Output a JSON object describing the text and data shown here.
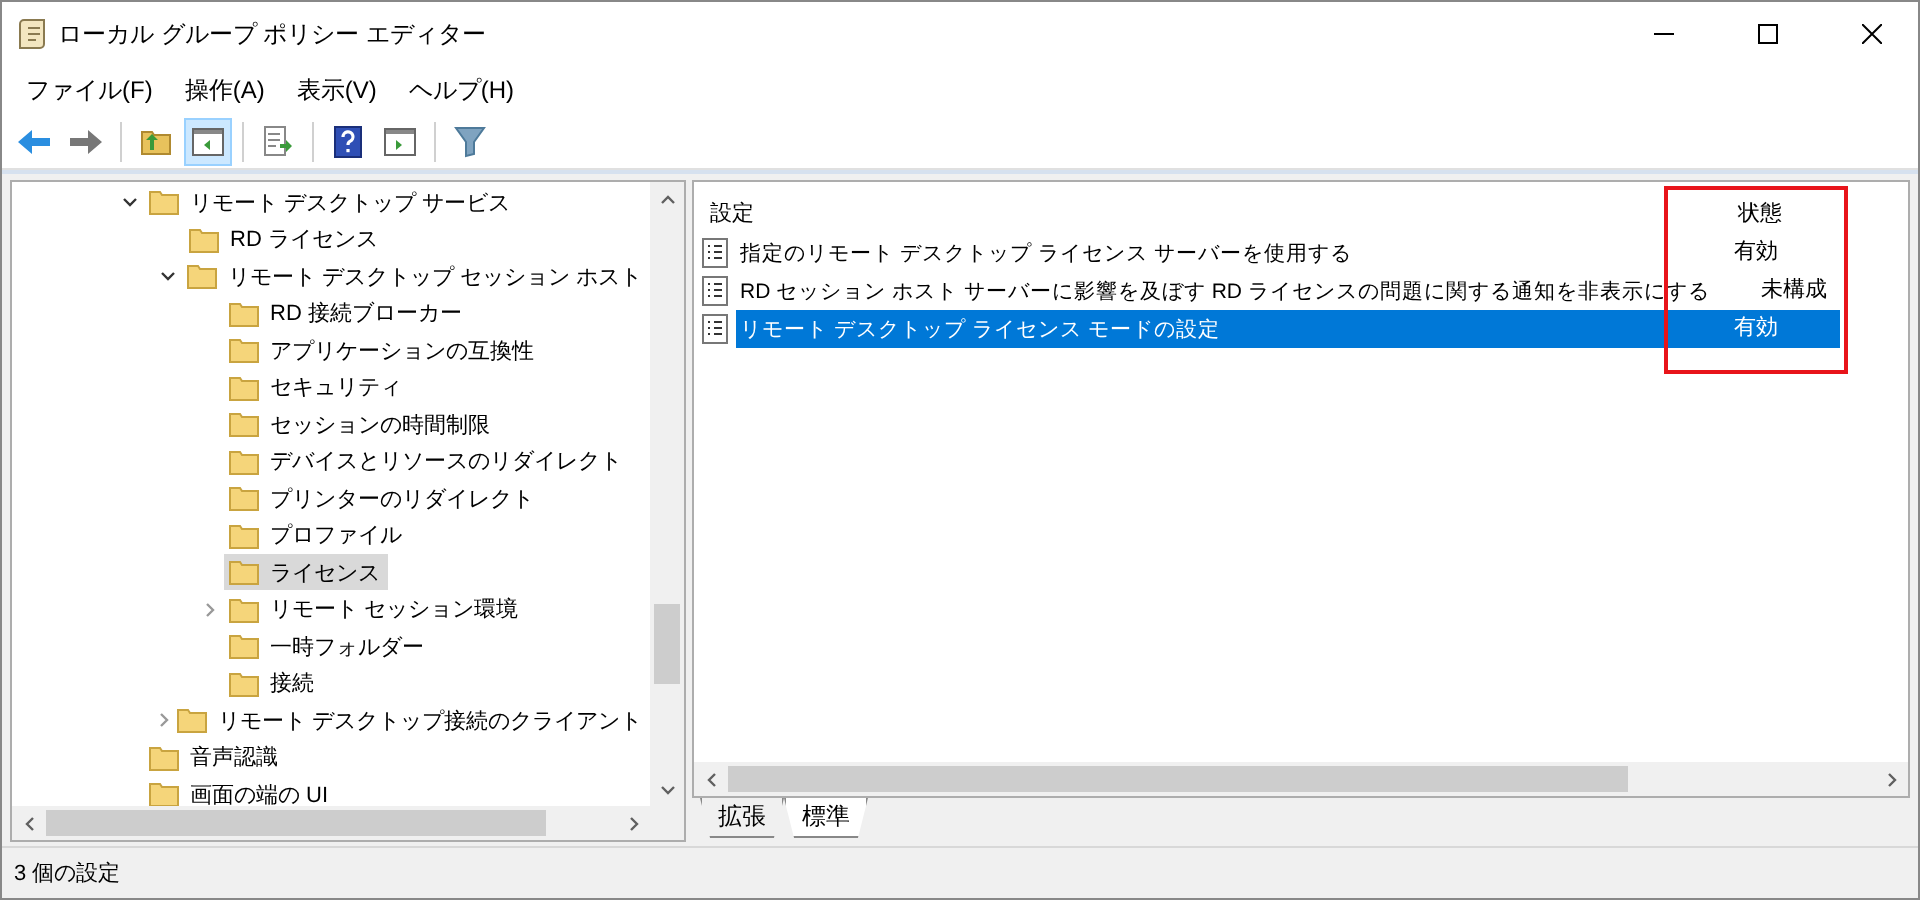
{
  "window": {
    "title": "ローカル グループ ポリシー エディター"
  },
  "menu": [
    "ファイル(F)",
    "操作(A)",
    "表示(V)",
    "ヘルプ(H)"
  ],
  "toolbar": [
    [
      {
        "kind": "back",
        "selected": false
      },
      {
        "kind": "forward",
        "selected": false
      }
    ],
    [
      {
        "kind": "up",
        "selected": false
      },
      {
        "kind": "tree",
        "selected": true
      }
    ],
    [
      {
        "kind": "export",
        "selected": false
      }
    ],
    [
      {
        "kind": "help",
        "selected": false
      },
      {
        "kind": "panel",
        "selected": false
      }
    ],
    [
      {
        "kind": "filter",
        "selected": false
      }
    ]
  ],
  "tree": [
    {
      "label": "リモート デスクトップ サービス",
      "expanded": true,
      "selected": false,
      "children": [
        {
          "label": "RD ライセンス",
          "selected": false
        },
        {
          "label": "リモート デスクトップ セッション ホスト",
          "expanded": true,
          "selected": false,
          "children": [
            {
              "label": "RD 接続ブローカー",
              "selected": false
            },
            {
              "label": "アプリケーションの互換性",
              "selected": false
            },
            {
              "label": "セキュリティ",
              "selected": false
            },
            {
              "label": "セッションの時間制限",
              "selected": false
            },
            {
              "label": "デバイスとリソースのリダイレクト",
              "selected": false
            },
            {
              "label": "プリンターのリダイレクト",
              "selected": false
            },
            {
              "label": "プロファイル",
              "selected": false
            },
            {
              "label": "ライセンス",
              "selected": true
            },
            {
              "label": "リモート セッション環境",
              "expanded": false,
              "selected": false
            },
            {
              "label": "一時フォルダー",
              "selected": false
            },
            {
              "label": "接続",
              "selected": false
            }
          ]
        },
        {
          "label": "リモート デスクトップ接続のクライアント",
          "expanded": false,
          "selected": false
        }
      ]
    },
    {
      "label": "音声認識",
      "selected": false
    },
    {
      "label": "画面の端の UI",
      "selected": false
    }
  ],
  "table": {
    "columns": [
      "設定",
      "状態"
    ],
    "rows": [
      {
        "setting": "指定のリモート デスクトップ ライセンス サーバーを使用する",
        "state": "有効",
        "selected": false
      },
      {
        "setting": "RD セッション ホスト サーバーに影響を及ぼす RD ライセンスの問題に関する通知を非表示にする",
        "state": "未構成",
        "selected": false
      },
      {
        "setting": "リモート デスクトップ ライセンス モードの設定",
        "state": "有効",
        "selected": true
      }
    ]
  },
  "tabs": [
    {
      "label": "拡張",
      "selected": false
    },
    {
      "label": "標準",
      "selected": true
    }
  ],
  "status_bar": "3 個の設定"
}
